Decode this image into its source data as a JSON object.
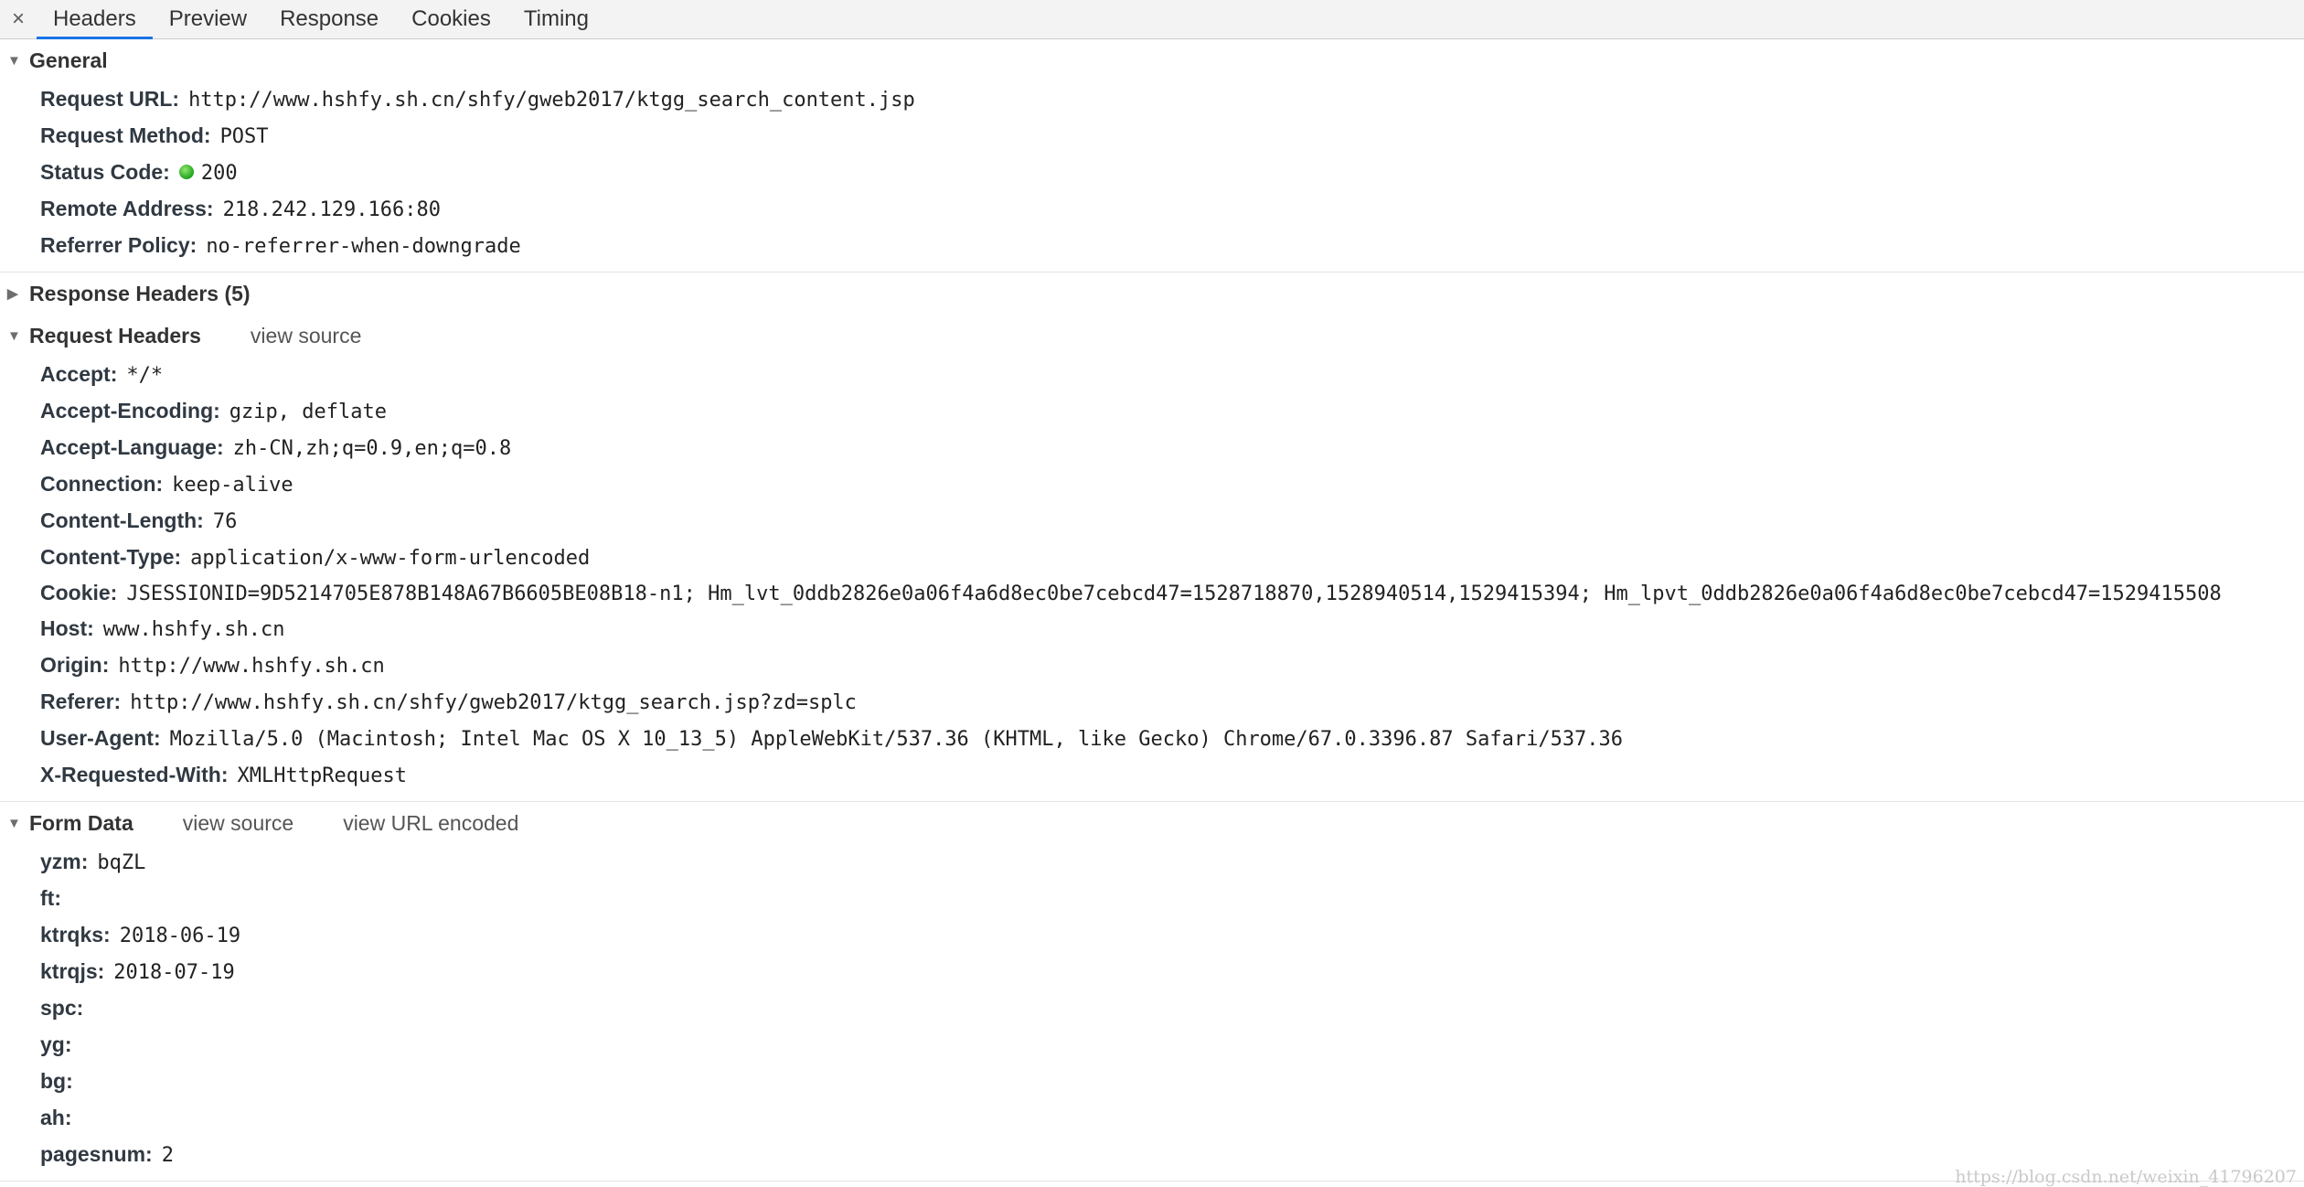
{
  "tabs": [
    "Headers",
    "Preview",
    "Response",
    "Cookies",
    "Timing"
  ],
  "close_symbol": "×",
  "general": {
    "title": "General",
    "rows": [
      {
        "key": "Request URL:",
        "value": "http://www.hshfy.sh.cn/shfy/gweb2017/ktgg_search_content.jsp"
      },
      {
        "key": "Request Method:",
        "value": "POST"
      },
      {
        "key": "Status Code:",
        "value": "200",
        "status_color": "#1fa31f"
      },
      {
        "key": "Remote Address:",
        "value": "218.242.129.166:80"
      },
      {
        "key": "Referrer Policy:",
        "value": "no-referrer-when-downgrade"
      }
    ]
  },
  "response_headers": {
    "title": "Response Headers (5)"
  },
  "request_headers": {
    "title": "Request Headers",
    "view_source": "view source",
    "rows": [
      {
        "key": "Accept:",
        "value": "*/*"
      },
      {
        "key": "Accept-Encoding:",
        "value": "gzip, deflate"
      },
      {
        "key": "Accept-Language:",
        "value": "zh-CN,zh;q=0.9,en;q=0.8"
      },
      {
        "key": "Connection:",
        "value": "keep-alive"
      },
      {
        "key": "Content-Length:",
        "value": "76"
      },
      {
        "key": "Content-Type:",
        "value": "application/x-www-form-urlencoded"
      },
      {
        "key": "Cookie:",
        "value": "JSESSIONID=9D5214705E878B148A67B6605BE08B18-n1; Hm_lvt_0ddb2826e0a06f4a6d8ec0be7cebcd47=1528718870,1528940514,1529415394; Hm_lpvt_0ddb2826e0a06f4a6d8ec0be7cebcd47=1529415508"
      },
      {
        "key": "Host:",
        "value": "www.hshfy.sh.cn"
      },
      {
        "key": "Origin:",
        "value": "http://www.hshfy.sh.cn"
      },
      {
        "key": "Referer:",
        "value": "http://www.hshfy.sh.cn/shfy/gweb2017/ktgg_search.jsp?zd=splc"
      },
      {
        "key": "User-Agent:",
        "value": "Mozilla/5.0 (Macintosh; Intel Mac OS X 10_13_5) AppleWebKit/537.36 (KHTML, like Gecko) Chrome/67.0.3396.87 Safari/537.36"
      },
      {
        "key": "X-Requested-With:",
        "value": "XMLHttpRequest"
      }
    ]
  },
  "form_data": {
    "title": "Form Data",
    "view_source": "view source",
    "view_url_encoded": "view URL encoded",
    "rows": [
      {
        "key": "yzm:",
        "value": "bqZL"
      },
      {
        "key": "ft:",
        "value": ""
      },
      {
        "key": "ktrqks:",
        "value": "2018-06-19"
      },
      {
        "key": "ktrqjs:",
        "value": "2018-07-19"
      },
      {
        "key": "spc:",
        "value": ""
      },
      {
        "key": "yg:",
        "value": ""
      },
      {
        "key": "bg:",
        "value": ""
      },
      {
        "key": "ah:",
        "value": ""
      },
      {
        "key": "pagesnum:",
        "value": "2"
      }
    ]
  },
  "watermark": "https://blog.csdn.net/weixin_41796207"
}
